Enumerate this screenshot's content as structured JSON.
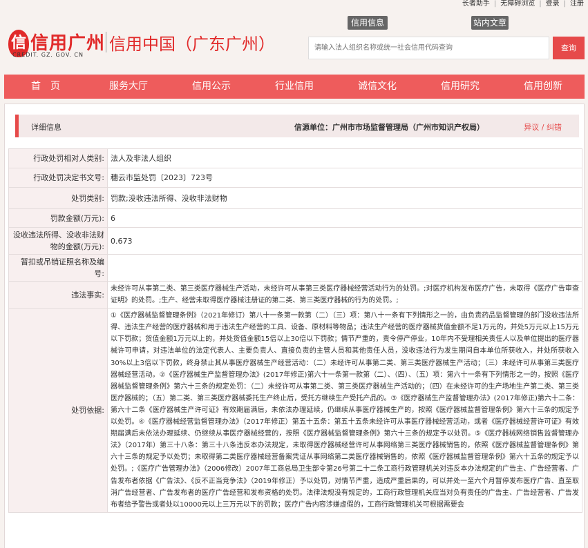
{
  "util_links": [
    "长者助手",
    "无障碍浏览",
    "登录",
    "注册"
  ],
  "header": {
    "logo_seal": "信",
    "logo_cn": "信用广州",
    "logo_en": "CREDIT. GZ. GOV. CN",
    "title": "信用中国（广东广州）",
    "tab_info": "信用信息",
    "tab_site": "站内文章",
    "search_placeholder": "请输入法人组织名称或统一社会信用代码查询",
    "search_button": "查询"
  },
  "nav": [
    "首　页",
    "服务大厅",
    "信用公示",
    "行业信用",
    "诚信文化",
    "信用研究",
    "信用创新"
  ],
  "detail": {
    "title": "详细信息",
    "source": "信源单位：广州市市场监督管理局（广州市知识产权局）",
    "objection": "异议 / 纠错"
  },
  "rows": [
    {
      "label": "行政处罚相对人类别:",
      "value": "法人及非法人组织"
    },
    {
      "label": "行政处罚决定书文号:",
      "value": "穗云市监处罚〔2023〕723号"
    },
    {
      "label": "处罚类别:",
      "value": "罚款;没收违法所得、没收非法财物"
    },
    {
      "label": "罚款金额(万元):",
      "value": "6"
    },
    {
      "label": "没收违法所得、没收非法财物的金额(万元):",
      "value": "0.673"
    },
    {
      "label": "暂扣或吊销证照名称及编号:",
      "value": ""
    },
    {
      "label": "违法事实:",
      "value": "未经许可从事第二类、第三类医疗器械生产活动，未经许可从事第三类医疗器械经营活动行为的处罚。;对医疗机构发布医疗广告，未取得《医疗广告审查证明》的处罚。;生产、经营未取得医疗器械注册证的第二类、第三类医疗器械的行为的处罚。;"
    },
    {
      "label": "处罚依据:",
      "value": "①《医疗器械监督管理条例》（2021年修订）第八十一条第一款第（二）（三）项：第八十一条有下列情形之一的，由负责药品监督管理的部门没收违法所得、违法生产经营的医疗器械和用于违法生产经营的工具、设备、原材料等物品；违法生产经营的医疗器械货值金额不足1万元的，并处5万元以上15万元以下罚款；货值金额1万元以上的，并处货值金额15倍以上30倍以下罚款；情节严重的，责令停产停业，10年内不受理相关责任人以及单位提出的医疗器械许可申请，对违法单位的法定代表人、主要负责人、直接负责的主管人员和其他责任人员，没收违法行为发生期间自本单位所获收入，并处所获收入30%以上3倍以下罚款，终身禁止其从事医疗器械生产经营活动：（二）未经许可从事第二类、第三类医疗器械生产活动；（三）未经许可从事第三类医疗器械经营活动。②《医疗器械生产监督管理办法》(2017年修正)第六十一条第一款第（二）、（四）、（五）项：第六十一条有下列情形之一的，按照《医疗器械监督管理条例》第六十三条的规定处罚：（二）未经许可从事第二类、第三类医疗器械生产活动的；（四）在未经许可的生产场地生产第二类、第三类医疗器械的；（五）第二类、第三类医疗器械委托生产终止后，受托方继续生产受托产品的。③《医疗器械生产监督管理办法》(2017年修正)第六十二条：第六十二条《医疗器械生产许可证》有效期届满后，未依法办理延续，仍继续从事医疗器械生产的，按照《医疗器械监督管理条例》第六十三条的规定予以处罚。④《医疗器械经营监督管理办法》（2017年修正）第五十五条：第五十五条未经许可从事医疗器械经营活动，或者《医疗器械经营许可证》有效期届满后未依法办理延续、仍继续从事医疗器械经营的，按照《医疗器械监督管理条例》第六十三条的规定予以处罚。⑤《医疗器械网络销售监督管理办法》（2017年）第三十八条：第三十八条违反本办法规定，未取得医疗器械经营许可从事网络第三类医疗器械销售的，依照《医疗器械监督管理条例》第六十三条的规定予以处罚；未取得第二类医疗器械经营备案凭证从事网络第二类医疗器械销售的，依照《医疗器械监督管理条例》第六十五条的规定予以处罚。;《医疗广告管理办法》（2006修改）2007年工商总局卫生部令第26号第二十二条工商行政管理机关对违反本办法规定的广告主、广告经营者、广告发布者依据《广告法》、《反不正当竞争法》（2019年修正）予以处罚，对情节严重，造成严重后果的，可以并处一至六个月暂停发布医疗广告、直至取消广告经营者、广告发布者的医疗广告经营和发布资格的处罚。法律法规没有规定的，工商行政管理机关应当对负有责任的广告主、广告经营者、广告发布者给予警告或者处以10000元以上三万元以下的罚款；医疗广告内容涉嫌虚假的，工商行政管理机关可根据需要会"
    }
  ]
}
